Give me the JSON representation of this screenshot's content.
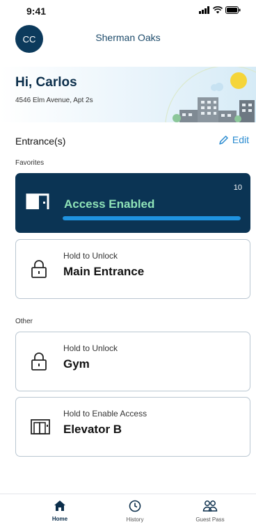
{
  "status_bar": {
    "time": "9:41"
  },
  "header": {
    "avatar_initials": "CC",
    "building_name": "Sherman Oaks"
  },
  "hero": {
    "greeting": "Hi, Carlos",
    "address": "4546 Elm Avenue, Apt 2s"
  },
  "entrances": {
    "section_title": "Entrance(s)",
    "edit_label": "Edit",
    "favorites_label": "Favorites",
    "active_card": {
      "status_text": "Access Enabled",
      "countdown": "10",
      "progress": 1.0
    },
    "favorites": [
      {
        "action": "Hold to Unlock",
        "name": "Main Entrance",
        "icon": "lock-icon"
      }
    ],
    "other_label": "Other",
    "other": [
      {
        "action": "Hold to Unlock",
        "name": "Gym",
        "icon": "lock-icon"
      },
      {
        "action": "Hold to Enable Access",
        "name": "Elevator B",
        "icon": "elevator-icon"
      }
    ]
  },
  "bottom_nav": {
    "items": [
      {
        "label": "Home",
        "icon": "home-icon",
        "active": true
      },
      {
        "label": "History",
        "icon": "clock-icon",
        "active": false
      },
      {
        "label": "Guest Pass",
        "icon": "guests-icon",
        "active": false
      }
    ]
  },
  "colors": {
    "primary_dark": "#0b3454",
    "accent_blue": "#2a8bd0",
    "success_green": "#8fe3b8",
    "progress_blue": "#1f93e0"
  }
}
